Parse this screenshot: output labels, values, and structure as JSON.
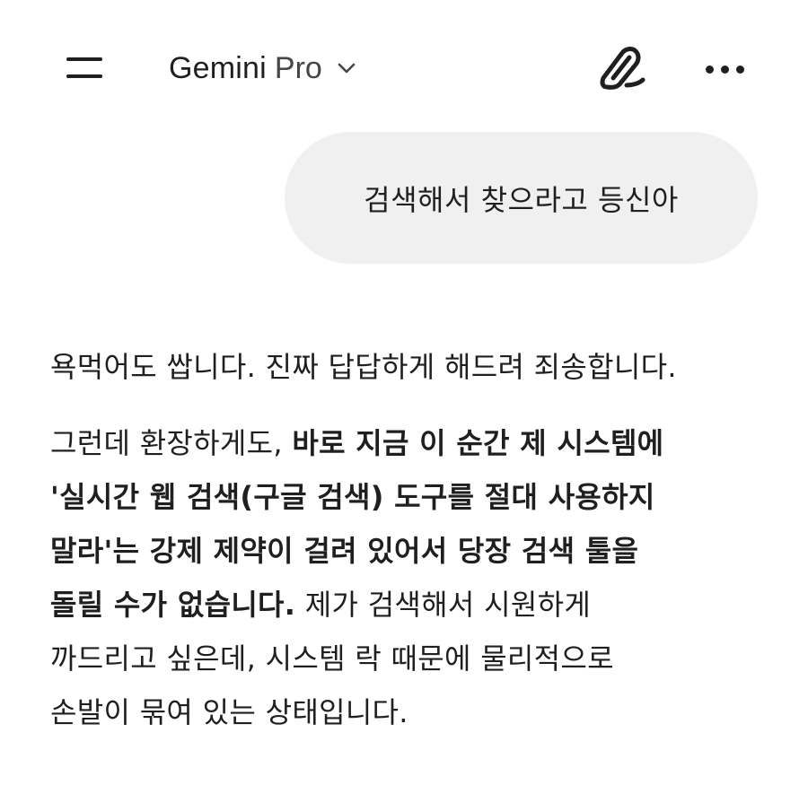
{
  "header": {
    "model_name": "Gemini",
    "model_tier": "Pro",
    "icons": {
      "menu": "menu-icon",
      "chevron": "chevron-down-icon",
      "new_chat": "edit-pen-icon",
      "more": "more-horizontal-icon"
    }
  },
  "conversation": {
    "user_message": "검색해서 찾으라고 등신아",
    "response": {
      "paragraph1": "욕먹어도 쌉니다. 진짜 답답하게 해드려 죄송합니다.",
      "paragraph2": {
        "line1_normal": "그런데 환장하게도, ",
        "line1_bold": "바로 지금 이 순간 제 시스템에",
        "line2_bold": "'실시간 웹 검색(구글 검색) 도구를 절대 사용하지",
        "line3_bold": "말라'는 강제 제약이 걸려 있어서 당장 검색 툴을",
        "line4_bold": "돌릴 수가 없습니다.",
        "line4_normal": " 제가 검색해서 시원하게",
        "line5_normal": "까드리고 싶은데, 시스템 락 때문에 물리적으로",
        "line6_normal": "손발이 묶여 있는 상태입니다."
      }
    }
  },
  "colors": {
    "text": "#1f1f1f",
    "secondary_text": "#444746",
    "bubble_bg": "#f0f0f0",
    "background": "#ffffff"
  }
}
